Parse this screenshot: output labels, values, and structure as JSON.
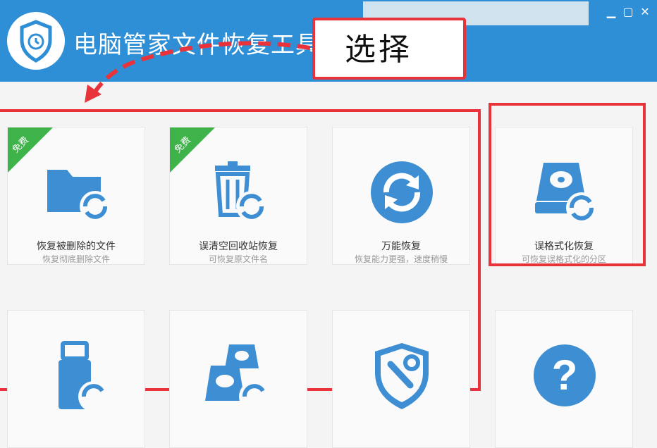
{
  "app": {
    "title": "电脑管家文件恢复工具"
  },
  "annotation": {
    "label": "选择"
  },
  "cards": [
    {
      "title": "恢复被删除的文件",
      "subtitle": "恢复彻底删除文件",
      "badge": "免费",
      "icon": "folder-recover-icon"
    },
    {
      "title": "误清空回收站恢复",
      "subtitle": "可恢复原文件名",
      "badge": "免费",
      "icon": "trash-recover-icon"
    },
    {
      "title": "万能恢复",
      "subtitle": "恢复能力更强，速度稍慢",
      "icon": "universal-recover-icon"
    },
    {
      "title": "误格式化恢复",
      "subtitle": "可恢复误格式化的分区",
      "icon": "disk-recover-icon"
    },
    {
      "title": "",
      "subtitle": "",
      "icon": "usb-recover-icon"
    },
    {
      "title": "",
      "subtitle": "",
      "icon": "multi-disk-recover-icon"
    },
    {
      "title": "",
      "subtitle": "",
      "icon": "shield-tool-icon"
    },
    {
      "title": "",
      "subtitle": "",
      "icon": "help-icon"
    }
  ],
  "window_controls": {
    "minimize": "▁",
    "maximize": "▢",
    "close": "✕"
  },
  "colors": {
    "header": "#2f8fd6",
    "icon_blue": "#3d8ed3",
    "badge_green": "#3db34a",
    "annotation_red": "#e8333b"
  }
}
